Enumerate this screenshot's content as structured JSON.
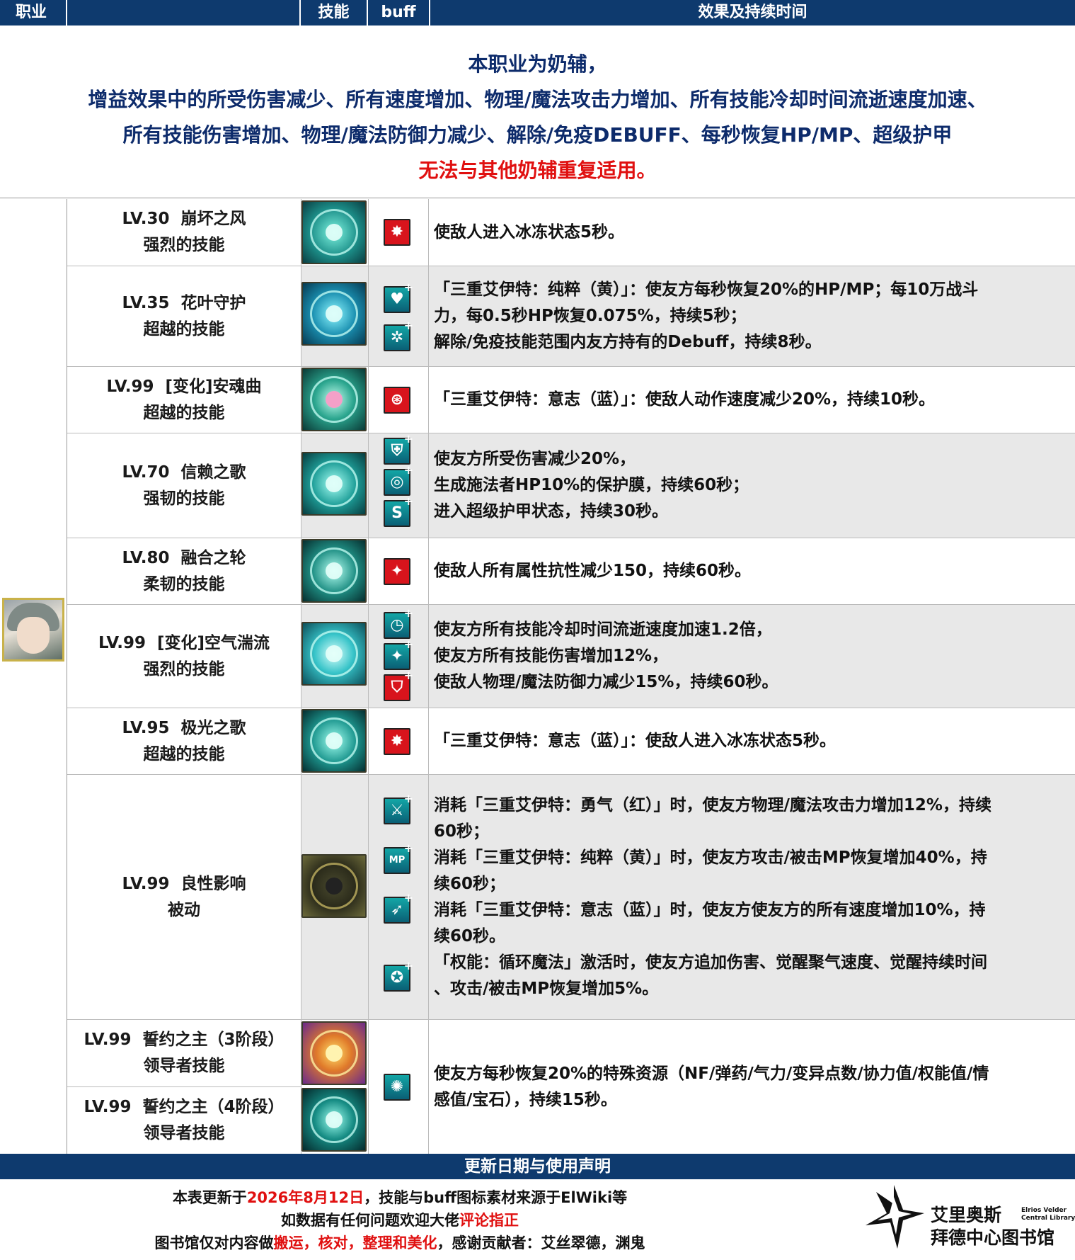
{
  "header": {
    "col_class": "职业",
    "col_skill": "技能",
    "col_buff": "buff",
    "col_effect": "效果及持续时间"
  },
  "intro": {
    "line1": "本职业为奶辅，",
    "line2": "增益效果中的所受伤害减少、所有速度增加、物理/魔法攻击力增加、所有技能冷却时间流逝速度加速、",
    "line3": "所有技能伤害增加、物理/魔法防御力减少、解除/免疫DEBUFF、每秒恢复HP/MP、超级护甲",
    "line4": "无法与其他奶辅重复适用。"
  },
  "rows": [
    {
      "lv": "LV.30",
      "name": "崩坏之风",
      "type": "强烈的技能",
      "effects": [
        "使敌人进入冰冻状态5秒。"
      ],
      "buff_icons": [
        "freeze-debuff-icon"
      ]
    },
    {
      "lv": "LV.35",
      "name": "花叶守护",
      "type": "超越的技能",
      "effects": [
        "「三重艾伊特：纯粹（黄）」：使友方每秒恢复20%的HP/MP；每10万战斗",
        "力，每0.5秒HP恢复0.075%，持续5秒；",
        "解除/免疫技能范围内友方持有的Debuff，持续8秒。"
      ],
      "buff_icons": [
        "heal-buff-icon",
        "cleanse-buff-icon"
      ]
    },
    {
      "lv": "LV.99",
      "name": "[变化]安魂曲",
      "type": "超越的技能",
      "effects": [
        "「三重艾伊特：意志（蓝）」：使敌人动作速度减少20%，持续10秒。"
      ],
      "buff_icons": [
        "slow-debuff-icon"
      ]
    },
    {
      "lv": "LV.70",
      "name": "信赖之歌",
      "type": "强韧的技能",
      "effects": [
        "使友方所受伤害减少20%，",
        "生成施法者HP10%的保护膜，持续60秒；",
        "进入超级护甲状态，持续30秒。"
      ],
      "buff_icons": [
        "damage-reduction-icon",
        "barrier-icon",
        "super-armor-icon"
      ]
    },
    {
      "lv": "LV.80",
      "name": "融合之轮",
      "type": "柔韧的技能",
      "effects": [
        "使敌人所有属性抗性减少150，持续60秒。"
      ],
      "buff_icons": [
        "resist-down-icon"
      ]
    },
    {
      "lv": "LV.99",
      "name": "[变化]空气湍流",
      "type": "强烈的技能",
      "effects": [
        "使友方所有技能冷却时间流逝速度加速1.2倍，",
        "使友方所有技能伤害增加12%，",
        "使敌人物理/魔法防御力减少15%，持续60秒。"
      ],
      "buff_icons": [
        "cooldown-icon",
        "skill-damage-icon",
        "defense-down-icon"
      ]
    },
    {
      "lv": "LV.95",
      "name": "极光之歌",
      "type": "超越的技能",
      "effects": [
        "「三重艾伊特：意志（蓝）」：使敌人进入冰冻状态5秒。"
      ],
      "buff_icons": [
        "freeze-debuff-icon"
      ]
    },
    {
      "lv": "LV.99",
      "name": "良性影响",
      "type": "被动",
      "effects": [
        "消耗「三重艾伊特：勇气（红）」时，使友方物理/魔法攻击力增加12%，持续",
        "60秒；",
        "消耗「三重艾伊特：纯粹（黄）」时，使友方攻击/被击MP恢复增加40%，持",
        "续60秒；",
        "消耗「三重艾伊特：意志（蓝）」时，使友方使友方的所有速度增加10%，持",
        "续60秒。",
        "「权能：循环魔法」激活时，使友方追加伤害、觉醒聚气速度、觉醒持续时间",
        "、攻击/被击MP恢复增加5%。"
      ],
      "buff_icons": [
        "attack-up-icon",
        "mp-regen-icon",
        "speed-up-icon",
        "awakening-icon"
      ]
    },
    {
      "lv": "LV.99",
      "name": "誓约之主（3阶段）",
      "type": "领导者技能"
    },
    {
      "lv": "LV.99",
      "name": "誓约之主（4阶段）",
      "type": "领导者技能",
      "effects": [
        "使友方每秒恢复20%的特殊资源（NF/弹药/气力/变异点数/协力值/权能值/情",
        "感值/宝石），持续15秒。"
      ],
      "buff_icons": [
        "resource-regen-icon"
      ]
    }
  ],
  "footer": {
    "title": "更新日期与使用声明",
    "l1_a": "本表更新于",
    "l1_date": "2026年8月12日",
    "l1_b": "，技能与buff图标素材来源于ElWiki等",
    "l2_a": "如数据有任何问题欢迎大佬",
    "l2_b": "评论指正",
    "l3_a": "图书馆仅对内容做",
    "l3_b": "搬运，核对，整理和美化",
    "l3_c": "，感谢贡献者：艾丝翠德，渊鬼"
  },
  "logo": {
    "cn1": "艾里奥斯",
    "en1": "Elrios Velder",
    "en2": "Central Library",
    "cn2": "拜德中心图书馆"
  },
  "colors": {
    "header_bg": "#0e3a6e",
    "intro_text": "#0d2b6b",
    "highlight_red": "#e01010",
    "buff_red": "#d8141c",
    "buff_teal": "#13a6a6"
  }
}
